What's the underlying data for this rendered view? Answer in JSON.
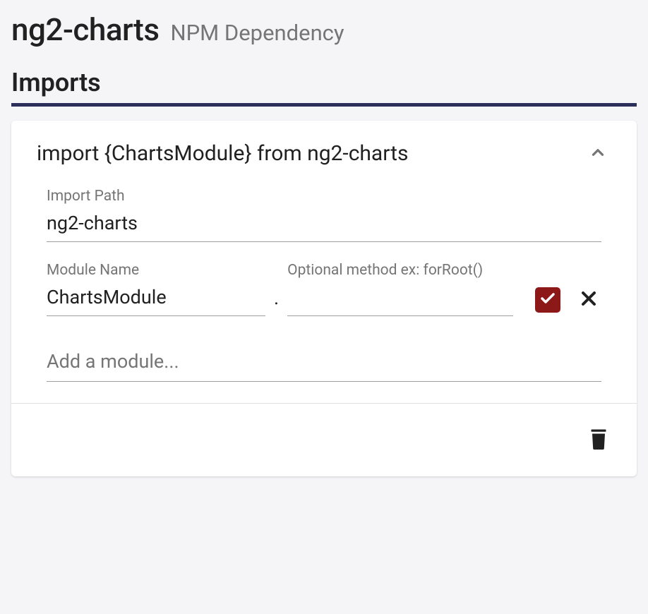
{
  "header": {
    "package_name": "ng2-charts",
    "subtitle": "NPM Dependency"
  },
  "section": {
    "title": "Imports"
  },
  "import_card": {
    "summary": "import {ChartsModule} from ng2-charts",
    "fields": {
      "import_path": {
        "label": "Import Path",
        "value": "ng2-charts"
      },
      "module_name": {
        "label": "Module Name",
        "value": "ChartsModule"
      },
      "optional_method": {
        "label": "Optional method ex: forRoot()",
        "value": ""
      },
      "separator": "."
    },
    "add_module": {
      "placeholder": "Add a module..."
    }
  }
}
